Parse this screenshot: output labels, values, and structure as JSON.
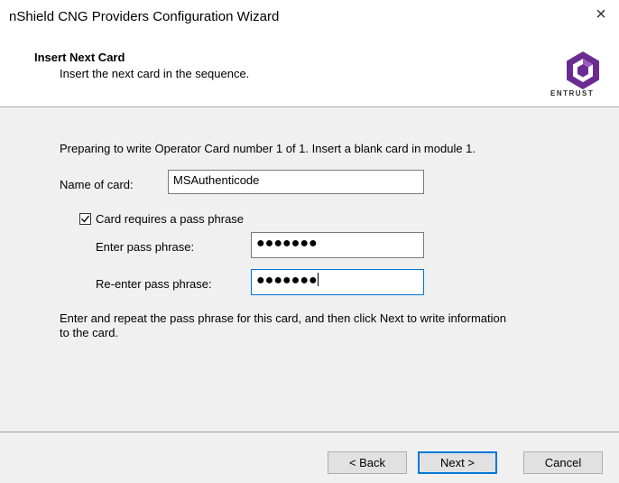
{
  "window": {
    "title": "nShield CNG Providers Configuration Wizard",
    "close_glyph": "×"
  },
  "header": {
    "title": "Insert Next Card",
    "subtitle": "Insert the next card in the sequence.",
    "logo_text": "ENTRUST",
    "logo_icon": "entrust-logo-icon",
    "brand_color": "#6b2c91"
  },
  "content": {
    "instruction": "Preparing to write Operator Card number 1 of 1. Insert a blank card in module 1.",
    "card_name_label": "Name of card:",
    "card_name_value": "MSAuthenticode",
    "pass_phrase_checkbox_label": "Card requires a pass phrase",
    "pass_phrase_checked": true,
    "enter_pass_label": "Enter pass phrase:",
    "enter_pass_value": "●●●●●●●",
    "reenter_pass_label": "Re-enter pass phrase:",
    "reenter_pass_value": "●●●●●●●",
    "help_line1": "Enter and repeat the pass phrase for this card, and then click Next to write information",
    "help_line2": "to the card."
  },
  "footer": {
    "back_label": "< Back",
    "next_label": "Next >",
    "cancel_label": "Cancel"
  }
}
